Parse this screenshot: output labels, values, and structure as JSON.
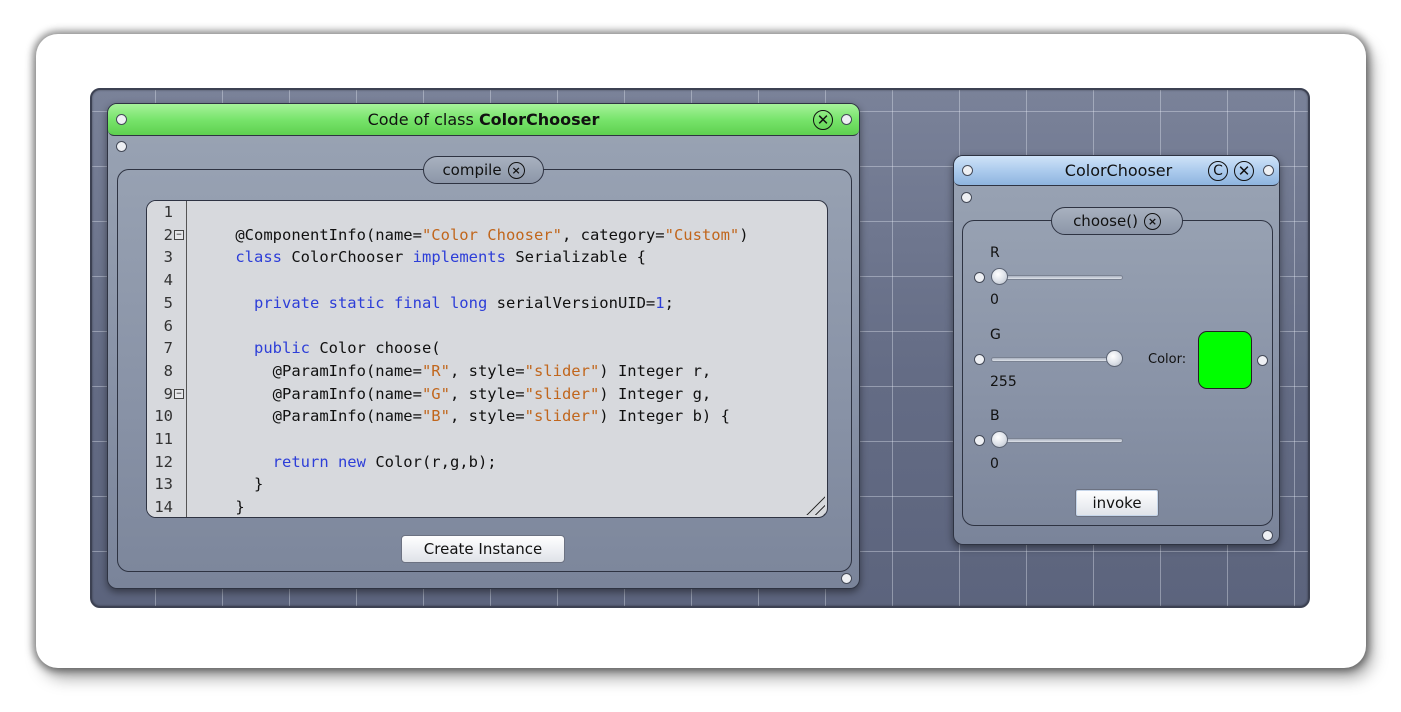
{
  "code_window": {
    "title_prefix": "Code of class ",
    "title_class": "ColorChooser",
    "close_symbol": "⊗",
    "compile_label": "compile",
    "compile_close_symbol": "×",
    "create_instance_label": "Create Instance",
    "line_numbers": [
      "1",
      "2",
      "3",
      "4",
      "5",
      "6",
      "7",
      "8",
      "9",
      "10",
      "11",
      "12",
      "13",
      "14"
    ],
    "code": {
      "l1_a": "@ComponentInfo(name=",
      "l1_b": "\"Color Chooser\"",
      "l1_c": ", category=",
      "l1_d": "\"Custom\"",
      "l1_e": ")",
      "l2_a": "class",
      "l2_b": " ColorChooser ",
      "l2_c": "implements",
      "l2_d": " Serializable {",
      "l4_a": "  private static final long",
      "l4_b": " serialVersionUID=",
      "l4_c": "1",
      "l4_d": ";",
      "l6_a": "  public",
      "l6_b": " Color choose(",
      "l7_a": "    @ParamInfo(name=",
      "l7_b": "\"R\"",
      "l7_c": ", style=",
      "l7_d": "\"slider\"",
      "l7_e": ") Integer r,",
      "l8_a": "    @ParamInfo(name=",
      "l8_b": "\"G\"",
      "l8_c": ", style=",
      "l8_d": "\"slider\"",
      "l8_e": ") Integer g,",
      "l9_a": "    @ParamInfo(name=",
      "l9_b": "\"B\"",
      "l9_c": ", style=",
      "l9_d": "\"slider\"",
      "l9_e": ") Integer b) {",
      "l11_a": "    return new",
      "l11_b": " Color(r,g,b);",
      "l12": "  }",
      "l13": "}"
    }
  },
  "chooser_window": {
    "title": "ColorChooser",
    "c_symbol": "C",
    "close_symbol": "×",
    "method_label": "choose()",
    "method_close_symbol": "×",
    "sliders": [
      {
        "name": "R",
        "value": "0",
        "fraction": 0.0
      },
      {
        "name": "G",
        "value": "255",
        "fraction": 1.0
      },
      {
        "name": "B",
        "value": "0",
        "fraction": 0.0
      }
    ],
    "color_label": "Color:",
    "color_value": "#00ff00",
    "invoke_label": "invoke"
  }
}
